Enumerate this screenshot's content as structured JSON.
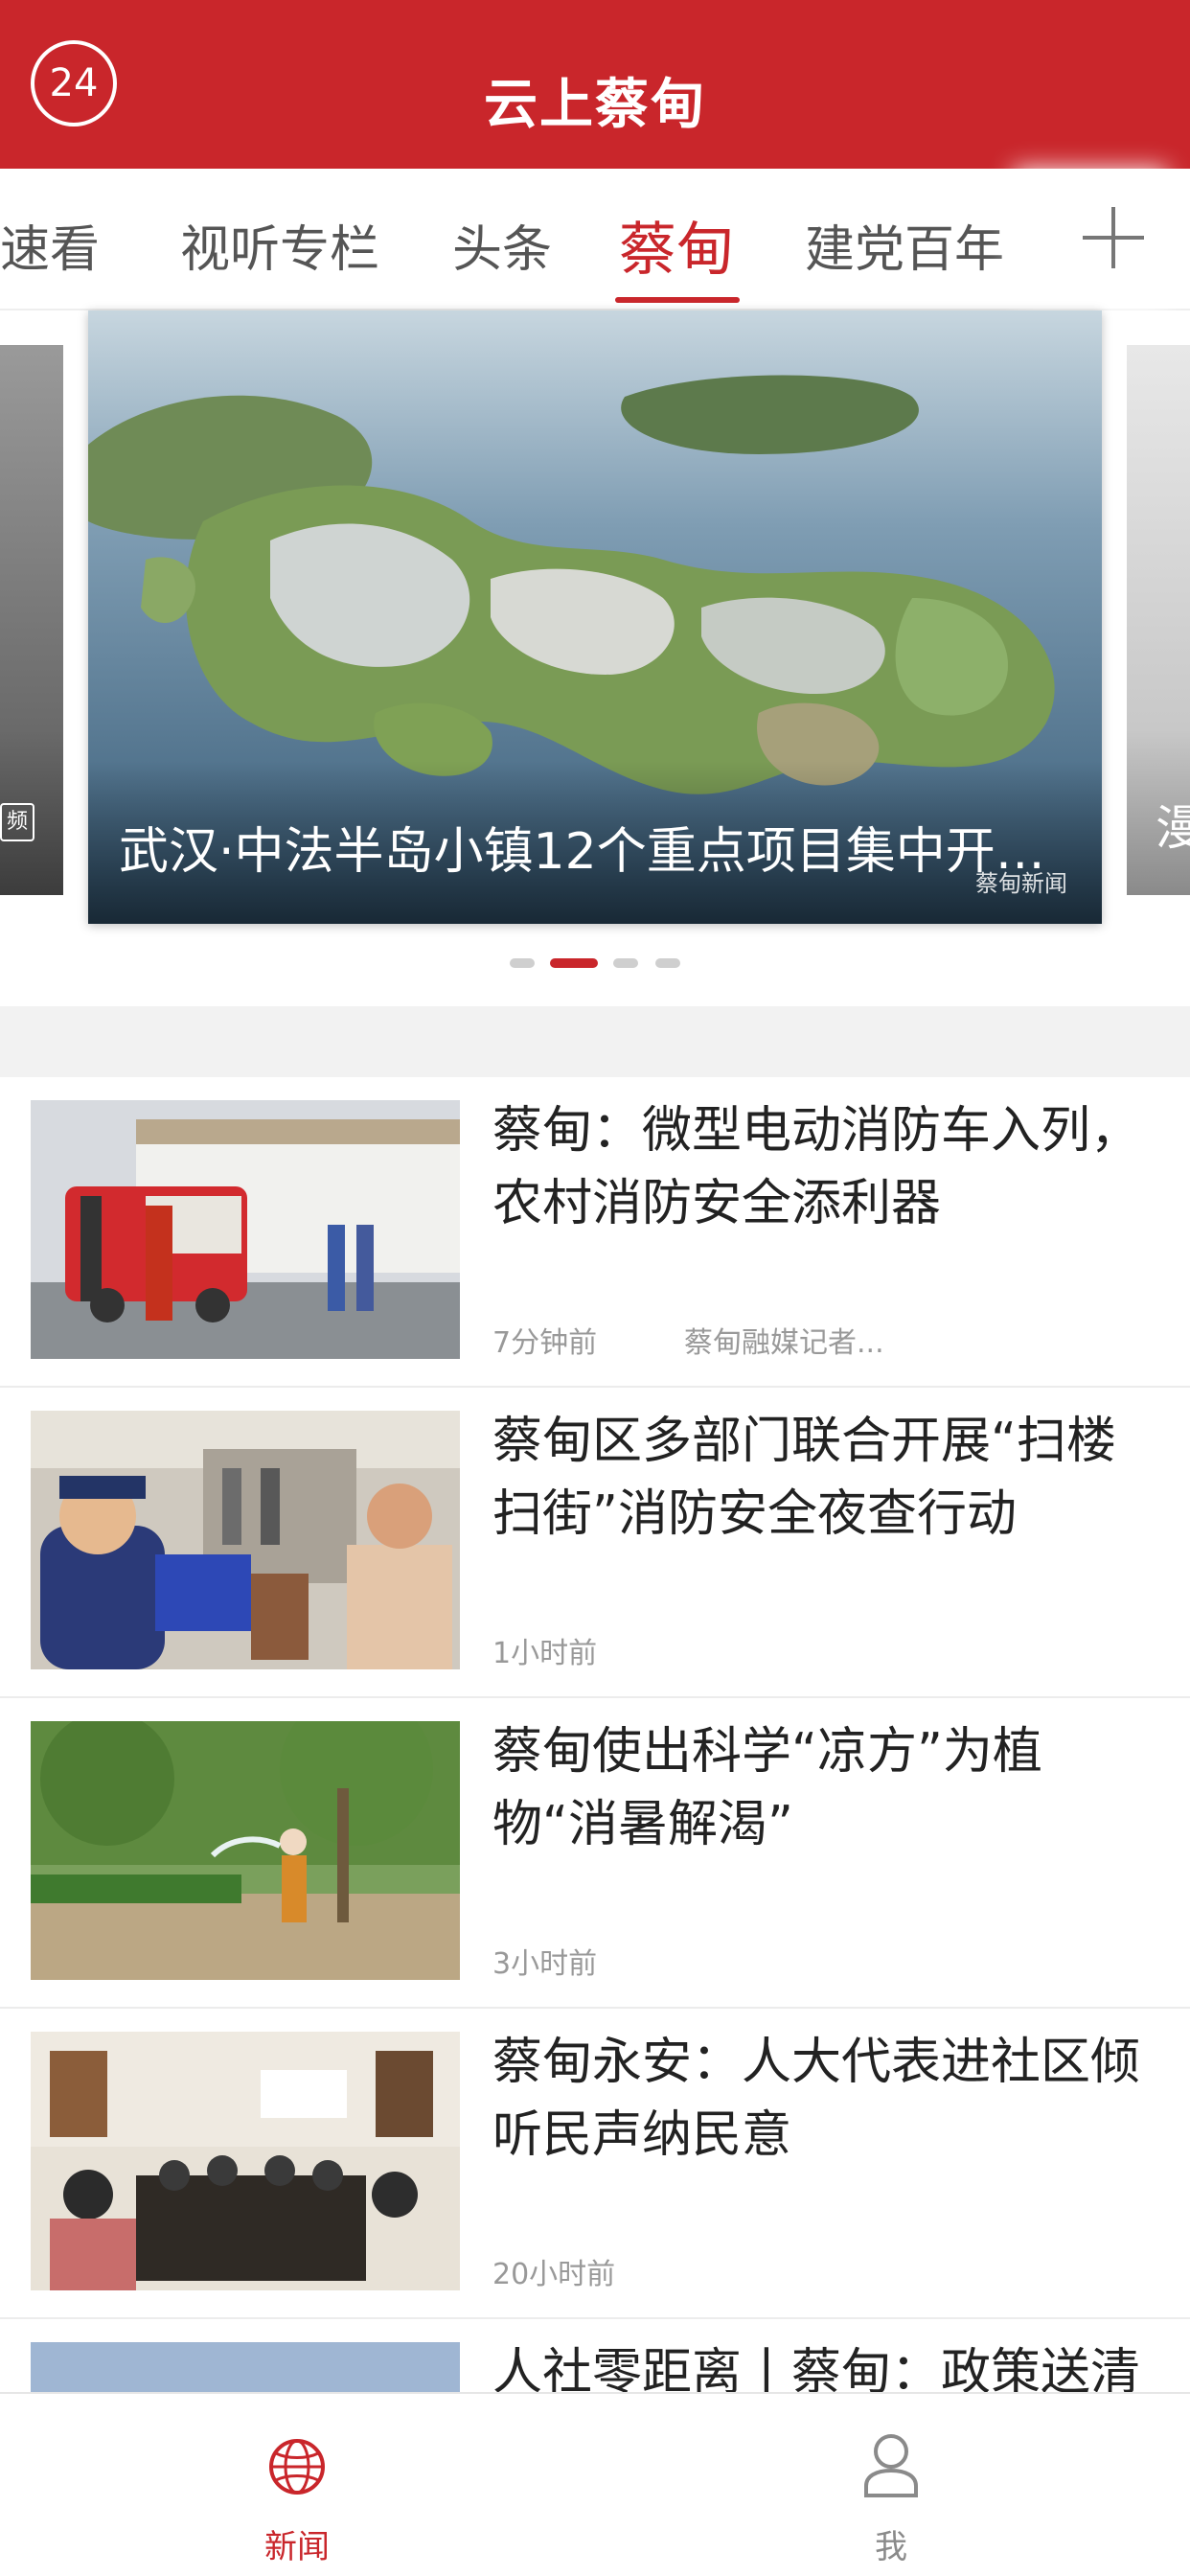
{
  "header": {
    "logo_text": "24",
    "title": "云上蔡甸"
  },
  "tabs": [
    {
      "label": "速看"
    },
    {
      "label": "视听专栏"
    },
    {
      "label": "头条"
    },
    {
      "label": "蔡甸",
      "active": true
    },
    {
      "label": "建党百年"
    }
  ],
  "carousel": {
    "left_peek_badge": "频",
    "right_peek_text": "漫",
    "caption": "武汉·中法半岛小镇12个重点项目集中开…",
    "watermark": "蔡甸新闻",
    "dot_count": 4,
    "active_index": 1
  },
  "news": [
    {
      "title": "蔡甸：微型电动消防车入列，农村消防安全添利器",
      "time": "7分钟前",
      "source": "蔡甸融媒记者..."
    },
    {
      "title": "蔡甸区多部门联合开展“扫楼扫街”消防安全夜查行动",
      "time": "1小时前",
      "source": ""
    },
    {
      "title": "蔡甸使出科学“凉方”为植物“消暑解渴”",
      "time": "3小时前",
      "source": ""
    },
    {
      "title": "蔡甸永安：人大代表进社区倾听民声纳民意",
      "time": "20小时前",
      "source": ""
    },
    {
      "title": "人社零距离丨蔡甸：政策送清",
      "time": "",
      "source": ""
    }
  ],
  "bottom_nav": [
    {
      "label": "新闻",
      "icon": "globe-icon",
      "active": true
    },
    {
      "label": "我",
      "icon": "user-icon",
      "active": false
    }
  ],
  "colors": {
    "brand": "#c9262b",
    "inactive": "#8a8a8a"
  }
}
